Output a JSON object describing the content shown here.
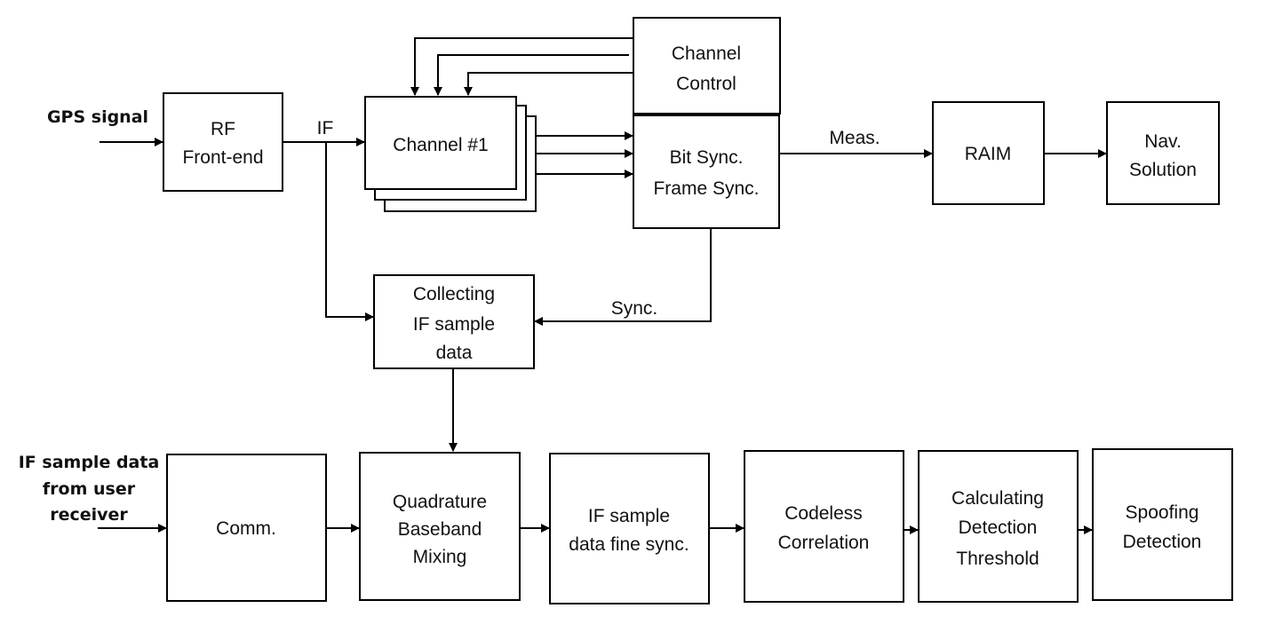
{
  "inputs": {
    "gps_signal": "GPS signal",
    "if_sample_user": [
      "IF sample data",
      "from user",
      "receiver"
    ]
  },
  "blocks": {
    "rf": [
      "RF",
      "Front-end"
    ],
    "channel": [
      "Channel #1"
    ],
    "channel_control": [
      "Channel",
      "Control"
    ],
    "bit_sync": [
      "Bit Sync.",
      "Frame Sync."
    ],
    "raim": [
      "RAIM"
    ],
    "nav": [
      "Nav.",
      "Solution"
    ],
    "collecting": [
      "Collecting",
      "IF sample",
      "data"
    ],
    "comm": [
      "Comm."
    ],
    "quad": [
      "Quadrature",
      "Baseband",
      "Mixing"
    ],
    "fine_sync": [
      "IF sample",
      "data fine sync."
    ],
    "codeless": [
      "Codeless",
      "Correlation"
    ],
    "threshold": [
      "Calculating",
      "Detection",
      "Threshold"
    ],
    "spoofing": [
      "Spoofing",
      "Detection"
    ]
  },
  "edge_labels": {
    "if": "IF",
    "meas": "Meas.",
    "sync": "Sync."
  }
}
